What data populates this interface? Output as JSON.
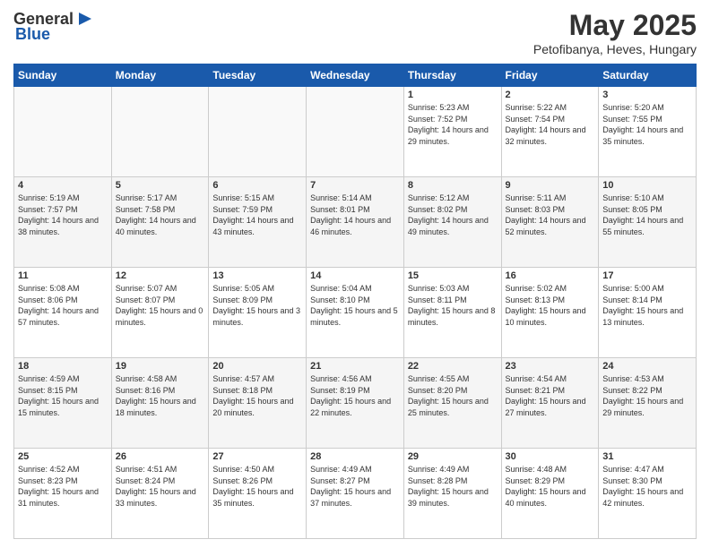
{
  "header": {
    "logo_general": "General",
    "logo_blue": "Blue",
    "title": "May 2025",
    "subtitle": "Petofibanya, Heves, Hungary"
  },
  "days_of_week": [
    "Sunday",
    "Monday",
    "Tuesday",
    "Wednesday",
    "Thursday",
    "Friday",
    "Saturday"
  ],
  "weeks": [
    [
      {
        "day": "",
        "info": ""
      },
      {
        "day": "",
        "info": ""
      },
      {
        "day": "",
        "info": ""
      },
      {
        "day": "",
        "info": ""
      },
      {
        "day": "1",
        "info": "Sunrise: 5:23 AM\nSunset: 7:52 PM\nDaylight: 14 hours and 29 minutes."
      },
      {
        "day": "2",
        "info": "Sunrise: 5:22 AM\nSunset: 7:54 PM\nDaylight: 14 hours and 32 minutes."
      },
      {
        "day": "3",
        "info": "Sunrise: 5:20 AM\nSunset: 7:55 PM\nDaylight: 14 hours and 35 minutes."
      }
    ],
    [
      {
        "day": "4",
        "info": "Sunrise: 5:19 AM\nSunset: 7:57 PM\nDaylight: 14 hours and 38 minutes."
      },
      {
        "day": "5",
        "info": "Sunrise: 5:17 AM\nSunset: 7:58 PM\nDaylight: 14 hours and 40 minutes."
      },
      {
        "day": "6",
        "info": "Sunrise: 5:15 AM\nSunset: 7:59 PM\nDaylight: 14 hours and 43 minutes."
      },
      {
        "day": "7",
        "info": "Sunrise: 5:14 AM\nSunset: 8:01 PM\nDaylight: 14 hours and 46 minutes."
      },
      {
        "day": "8",
        "info": "Sunrise: 5:12 AM\nSunset: 8:02 PM\nDaylight: 14 hours and 49 minutes."
      },
      {
        "day": "9",
        "info": "Sunrise: 5:11 AM\nSunset: 8:03 PM\nDaylight: 14 hours and 52 minutes."
      },
      {
        "day": "10",
        "info": "Sunrise: 5:10 AM\nSunset: 8:05 PM\nDaylight: 14 hours and 55 minutes."
      }
    ],
    [
      {
        "day": "11",
        "info": "Sunrise: 5:08 AM\nSunset: 8:06 PM\nDaylight: 14 hours and 57 minutes."
      },
      {
        "day": "12",
        "info": "Sunrise: 5:07 AM\nSunset: 8:07 PM\nDaylight: 15 hours and 0 minutes."
      },
      {
        "day": "13",
        "info": "Sunrise: 5:05 AM\nSunset: 8:09 PM\nDaylight: 15 hours and 3 minutes."
      },
      {
        "day": "14",
        "info": "Sunrise: 5:04 AM\nSunset: 8:10 PM\nDaylight: 15 hours and 5 minutes."
      },
      {
        "day": "15",
        "info": "Sunrise: 5:03 AM\nSunset: 8:11 PM\nDaylight: 15 hours and 8 minutes."
      },
      {
        "day": "16",
        "info": "Sunrise: 5:02 AM\nSunset: 8:13 PM\nDaylight: 15 hours and 10 minutes."
      },
      {
        "day": "17",
        "info": "Sunrise: 5:00 AM\nSunset: 8:14 PM\nDaylight: 15 hours and 13 minutes."
      }
    ],
    [
      {
        "day": "18",
        "info": "Sunrise: 4:59 AM\nSunset: 8:15 PM\nDaylight: 15 hours and 15 minutes."
      },
      {
        "day": "19",
        "info": "Sunrise: 4:58 AM\nSunset: 8:16 PM\nDaylight: 15 hours and 18 minutes."
      },
      {
        "day": "20",
        "info": "Sunrise: 4:57 AM\nSunset: 8:18 PM\nDaylight: 15 hours and 20 minutes."
      },
      {
        "day": "21",
        "info": "Sunrise: 4:56 AM\nSunset: 8:19 PM\nDaylight: 15 hours and 22 minutes."
      },
      {
        "day": "22",
        "info": "Sunrise: 4:55 AM\nSunset: 8:20 PM\nDaylight: 15 hours and 25 minutes."
      },
      {
        "day": "23",
        "info": "Sunrise: 4:54 AM\nSunset: 8:21 PM\nDaylight: 15 hours and 27 minutes."
      },
      {
        "day": "24",
        "info": "Sunrise: 4:53 AM\nSunset: 8:22 PM\nDaylight: 15 hours and 29 minutes."
      }
    ],
    [
      {
        "day": "25",
        "info": "Sunrise: 4:52 AM\nSunset: 8:23 PM\nDaylight: 15 hours and 31 minutes."
      },
      {
        "day": "26",
        "info": "Sunrise: 4:51 AM\nSunset: 8:24 PM\nDaylight: 15 hours and 33 minutes."
      },
      {
        "day": "27",
        "info": "Sunrise: 4:50 AM\nSunset: 8:26 PM\nDaylight: 15 hours and 35 minutes."
      },
      {
        "day": "28",
        "info": "Sunrise: 4:49 AM\nSunset: 8:27 PM\nDaylight: 15 hours and 37 minutes."
      },
      {
        "day": "29",
        "info": "Sunrise: 4:49 AM\nSunset: 8:28 PM\nDaylight: 15 hours and 39 minutes."
      },
      {
        "day": "30",
        "info": "Sunrise: 4:48 AM\nSunset: 8:29 PM\nDaylight: 15 hours and 40 minutes."
      },
      {
        "day": "31",
        "info": "Sunrise: 4:47 AM\nSunset: 8:30 PM\nDaylight: 15 hours and 42 minutes."
      }
    ]
  ]
}
